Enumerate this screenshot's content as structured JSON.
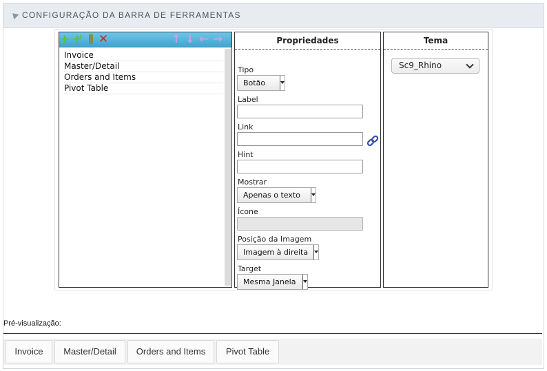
{
  "panel": {
    "title": "CONFIGURAÇÃO DA BARRA DE FERRAMENTAS"
  },
  "tree": {
    "toolbar_icons": [
      "add-icon",
      "add-child-icon",
      "separator-icon",
      "delete-icon",
      "move-up-icon",
      "move-down-icon",
      "move-left-icon",
      "move-right-icon"
    ],
    "items": [
      "Invoice",
      "Master/Detail",
      "Orders and Items",
      "Pivot Table"
    ]
  },
  "properties": {
    "header": "Propriedades",
    "tipo_label": "Tipo",
    "tipo_value": "Botão",
    "label_label": "Label",
    "label_value": "",
    "link_label": "Link",
    "link_value": "",
    "hint_label": "Hint",
    "hint_value": "",
    "mostrar_label": "Mostrar",
    "mostrar_value": "Apenas o texto",
    "icone_label": "Ícone",
    "posicao_label": "Posição da Imagem",
    "posicao_value": "Imagem à direita",
    "target_label": "Target",
    "target_value": "Mesma Janela"
  },
  "theme": {
    "header": "Tema",
    "selected": "Sc9_Rhino"
  },
  "preview": {
    "label": "Pré-visualização:",
    "buttons": [
      "Invoice",
      "Master/Detail",
      "Orders and Items",
      "Pivot Table"
    ]
  },
  "colors": {
    "toolbar_top": "#6fc6e8",
    "toolbar_bottom": "#3ea2cd",
    "add_green": "#5bbf3a",
    "delete_red": "#e02020",
    "move_purple": "#c7a3e0"
  }
}
